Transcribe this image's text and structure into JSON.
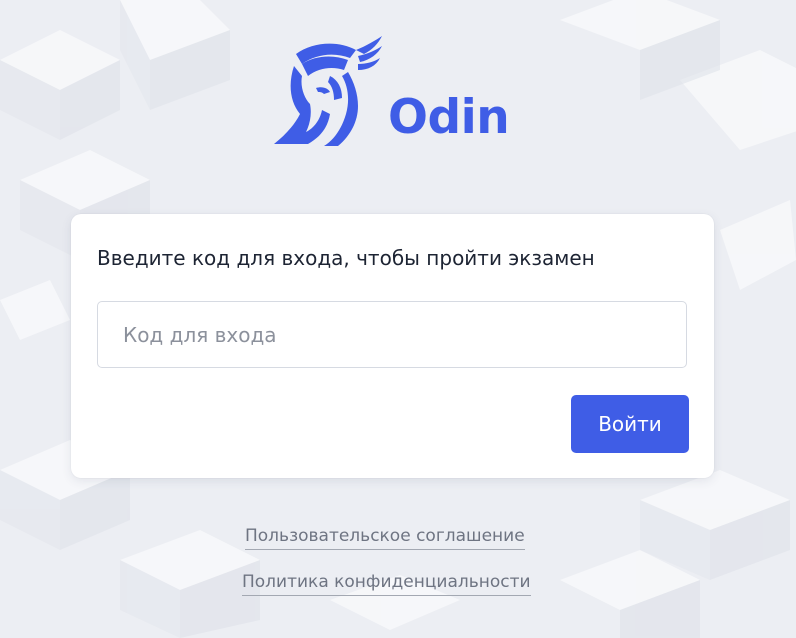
{
  "brand": {
    "name": "Odin",
    "logo_icon": "odin-winged-helmet-icon",
    "accent_color": "#3f5de6"
  },
  "login_card": {
    "title": "Введите код для входа, чтобы пройти экзамен",
    "code_field": {
      "placeholder": "Код для входа",
      "value": ""
    },
    "submit_label": "Войти"
  },
  "footer": {
    "user_agreement": "Пользовательское соглашение",
    "privacy_policy": "Политика конфиденциальности"
  }
}
